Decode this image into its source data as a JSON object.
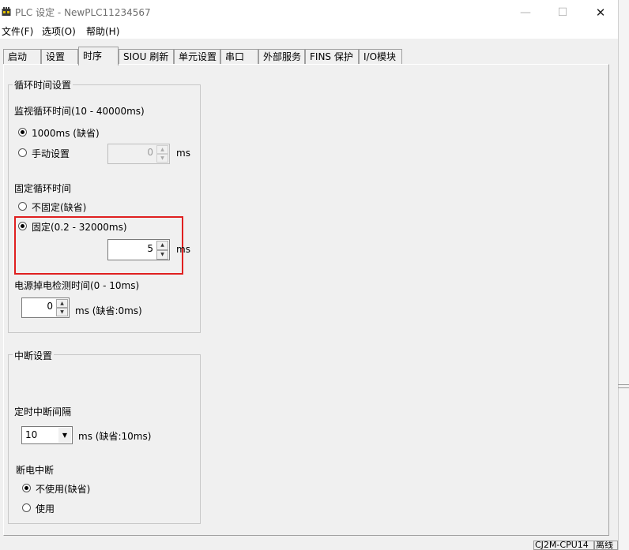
{
  "window": {
    "title": "PLC 设定 - NewPLC11234567",
    "minimize_icon": "—",
    "maximize_icon": "☐",
    "close_icon": "✕"
  },
  "menu": {
    "file": "文件(F)",
    "options": "选项(O)",
    "help": "帮助(H)"
  },
  "tabs": [
    {
      "label": "启动",
      "active": false
    },
    {
      "label": "设置",
      "active": false
    },
    {
      "label": "时序",
      "active": true
    },
    {
      "label": "SIOU 刷新",
      "active": false
    },
    {
      "label": "单元设置",
      "active": false
    },
    {
      "label": "串口",
      "active": false
    },
    {
      "label": "外部服务",
      "active": false
    },
    {
      "label": "FINS 保护",
      "active": false
    },
    {
      "label": "I/O模块",
      "active": false
    }
  ],
  "cycle_time": {
    "group_title": "循环时间设置",
    "watch_label": "监视循环时间(10 - 40000ms)",
    "option_default": "1000ms (缺省)",
    "option_manual": "手动设置",
    "manual_value": "0",
    "manual_unit": "ms",
    "selected": "default",
    "fixed_label": "固定循环时间",
    "fixed_option_none": "不固定(缺省)",
    "fixed_option_fixed": "固定(0.2 - 32000ms)",
    "fixed_selected": "fixed",
    "fixed_value": "5",
    "fixed_unit": "ms",
    "power_label": "电源掉电检测时间(0 - 10ms)",
    "power_value": "0",
    "power_unit": "ms (缺省:0ms)"
  },
  "interrupt": {
    "group_title": "中断设置",
    "timer_label": "定时中断间隔",
    "timer_value": "10",
    "timer_unit": "ms (缺省:10ms)",
    "power_off_label": "断电中断",
    "option_not_used": "不使用(缺省)",
    "option_used": "使用",
    "selected": "not_used"
  },
  "status": {
    "model": "CJ2M-CPU14",
    "connection": "离线"
  },
  "colors": {
    "highlight": "#e02020",
    "dialog_bg": "#f0f0f0"
  },
  "icons": {
    "spin_up": "▲",
    "spin_down": "▼",
    "combo_arrow": "▼"
  }
}
